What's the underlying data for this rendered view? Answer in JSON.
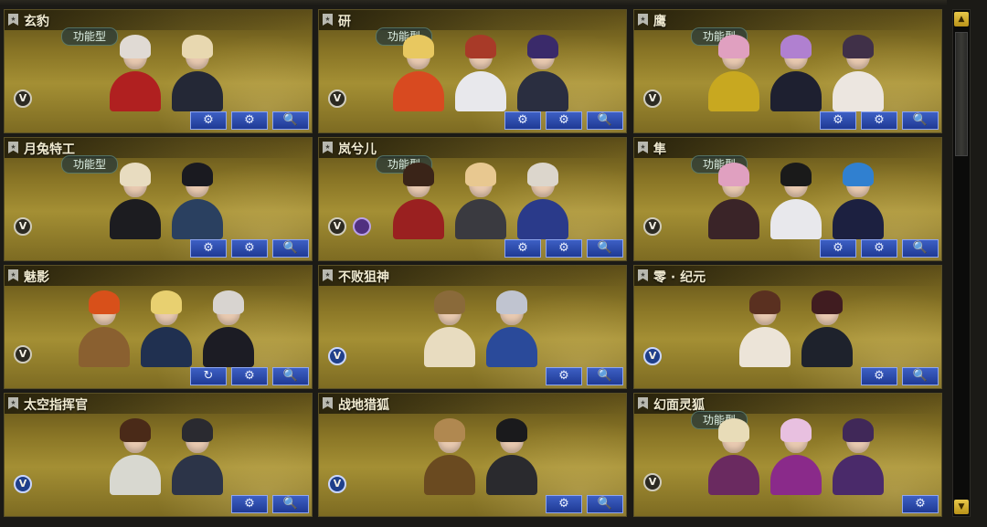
{
  "cards": [
    {
      "name": "玄豹",
      "badge": "功能型",
      "mark": "V",
      "mark_style": "dark",
      "chars": 2,
      "buttons": [
        "gear-wrench",
        "gear",
        "search"
      ],
      "palette": [
        [
          "#e0dad4",
          "#b02020"
        ],
        [
          "#e8d8b0",
          "#242836"
        ]
      ]
    },
    {
      "name": "研",
      "badge": "功能型",
      "mark": "V",
      "mark_style": "dark",
      "chars": 3,
      "buttons": [
        "gear-wrench",
        "gear",
        "search"
      ],
      "palette": [
        [
          "#e8c860",
          "#d84a20"
        ],
        [
          "#a83a28",
          "#e8e8ec"
        ],
        [
          "#3a2a6a",
          "#2a2e40"
        ]
      ]
    },
    {
      "name": "鹰",
      "badge": "功能型",
      "mark": "V",
      "mark_style": "dark",
      "chars": 3,
      "buttons": [
        "gear-wrench",
        "gear",
        "search"
      ],
      "palette": [
        [
          "#e0a0c0",
          "#c8a820"
        ],
        [
          "#b080d0",
          "#1e2030"
        ],
        [
          "#403048",
          "#ece6e0"
        ]
      ]
    },
    {
      "name": "月兔特工",
      "badge": "功能型",
      "mark": "V",
      "mark_style": "dark",
      "chars": 2,
      "buttons": [
        "gear-wrench",
        "gear",
        "search"
      ],
      "palette": [
        [
          "#e8dcc0",
          "#1c1c20"
        ],
        [
          "#1a1a20",
          "#2a4060"
        ]
      ]
    },
    {
      "name": "岚兮儿",
      "badge": "功能型",
      "mark": "V",
      "mark_style": "dark",
      "extra_mark": true,
      "chars": 3,
      "buttons": [
        "gear-wrench",
        "gear",
        "search"
      ],
      "palette": [
        [
          "#3a2418",
          "#9a2020"
        ],
        [
          "#e8c890",
          "#3a3a40"
        ],
        [
          "#dcd6cc",
          "#2a3a8a"
        ]
      ]
    },
    {
      "name": "隼",
      "badge": "功能型",
      "mark": "V",
      "mark_style": "dark",
      "chars": 3,
      "buttons": [
        "gear-wrench",
        "gear",
        "search"
      ],
      "palette": [
        [
          "#e0a0c0",
          "#3a2428"
        ],
        [
          "#1a1a1a",
          "#e8e8ec"
        ],
        [
          "#3080d0",
          "#1c2040"
        ]
      ]
    },
    {
      "name": "魅影",
      "badge": "",
      "mark": "V",
      "mark_style": "dark",
      "chars": 3,
      "buttons": [
        "rotate",
        "gear",
        "search"
      ],
      "palette": [
        [
          "#d8501a",
          "#8a6030"
        ],
        [
          "#e8d070",
          "#203050"
        ],
        [
          "#d8d4d0",
          "#1c1c24"
        ]
      ]
    },
    {
      "name": "不败狙神",
      "badge": "",
      "mark": "V",
      "mark_style": "blue",
      "chars": 2,
      "buttons": [
        "gear",
        "search"
      ],
      "palette": [
        [
          "#8a6a3a",
          "#e8dcc0"
        ],
        [
          "#c0c4d0",
          "#2a4a9a"
        ]
      ]
    },
    {
      "name": "零 · 纪元",
      "badge": "",
      "mark": "V",
      "mark_style": "blue",
      "chars": 2,
      "buttons": [
        "gear",
        "search"
      ],
      "palette": [
        [
          "#5a3020",
          "#ece4d8"
        ],
        [
          "#401c20",
          "#1e222c"
        ]
      ]
    },
    {
      "name": "太空指挥官",
      "badge": "",
      "mark": "V",
      "mark_style": "blue",
      "chars": 2,
      "buttons": [
        "gear",
        "search"
      ],
      "palette": [
        [
          "#4a2a18",
          "#d8d8d0"
        ],
        [
          "#2a2a30",
          "#2c3448"
        ]
      ]
    },
    {
      "name": "战地猎狐",
      "badge": "",
      "mark": "V",
      "mark_style": "blue",
      "chars": 2,
      "buttons": [
        "gear",
        "search"
      ],
      "palette": [
        [
          "#b08850",
          "#6a4a20"
        ],
        [
          "#1a1a1c",
          "#2a2a2e"
        ]
      ]
    },
    {
      "name": "幻面灵狐",
      "badge": "功能型",
      "mark": "V",
      "mark_style": "dark",
      "chars": 3,
      "buttons": [
        "gear-wrench"
      ],
      "palette": [
        [
          "#e8dcb8",
          "#6a2a60"
        ],
        [
          "#e8c0e0",
          "#8a2a8a"
        ],
        [
          "#402858",
          "#4a2a6a"
        ]
      ]
    }
  ],
  "icons": {
    "gear-wrench": "⚙",
    "gear": "⚙",
    "search": "🔍",
    "rotate": "↻"
  },
  "scroll": {
    "up": "▲",
    "down": "▼"
  }
}
